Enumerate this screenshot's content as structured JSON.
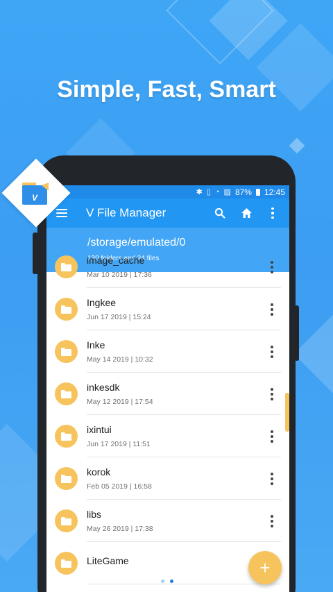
{
  "promo": {
    "headline": "Simple, Fast, Smart"
  },
  "status_bar": {
    "battery": "87%",
    "time": "12:45"
  },
  "app_bar": {
    "title": "V File Manager"
  },
  "path_bar": {
    "path": "/storage/emulated/0",
    "summary": "130 folders and 24 files"
  },
  "files": [
    {
      "name": "image_cache",
      "date": "Mar 10 2019 | 17:36"
    },
    {
      "name": "Ingkee",
      "date": "Jun 17 2019 | 15:24"
    },
    {
      "name": "Inke",
      "date": "May 14 2019 | 10:32"
    },
    {
      "name": "inkesdk",
      "date": "May 12 2019 | 17:54"
    },
    {
      "name": "ixintui",
      "date": "Jun 17 2019 | 11:51"
    },
    {
      "name": "korok",
      "date": "Feb 05 2019 | 16:58"
    },
    {
      "name": "libs",
      "date": "May 26 2019 | 17:38"
    },
    {
      "name": "LiteGame",
      "date": ""
    }
  ],
  "fab": {
    "icon": "plus-icon"
  },
  "pager": {
    "count": 2,
    "active": 1
  },
  "colors": {
    "accent": "#2196f3",
    "path_bar": "#42a5f5",
    "folder": "#f7c35c",
    "pager_active": "#1f7fd6",
    "pager_inactive": "#9fd0f7"
  }
}
